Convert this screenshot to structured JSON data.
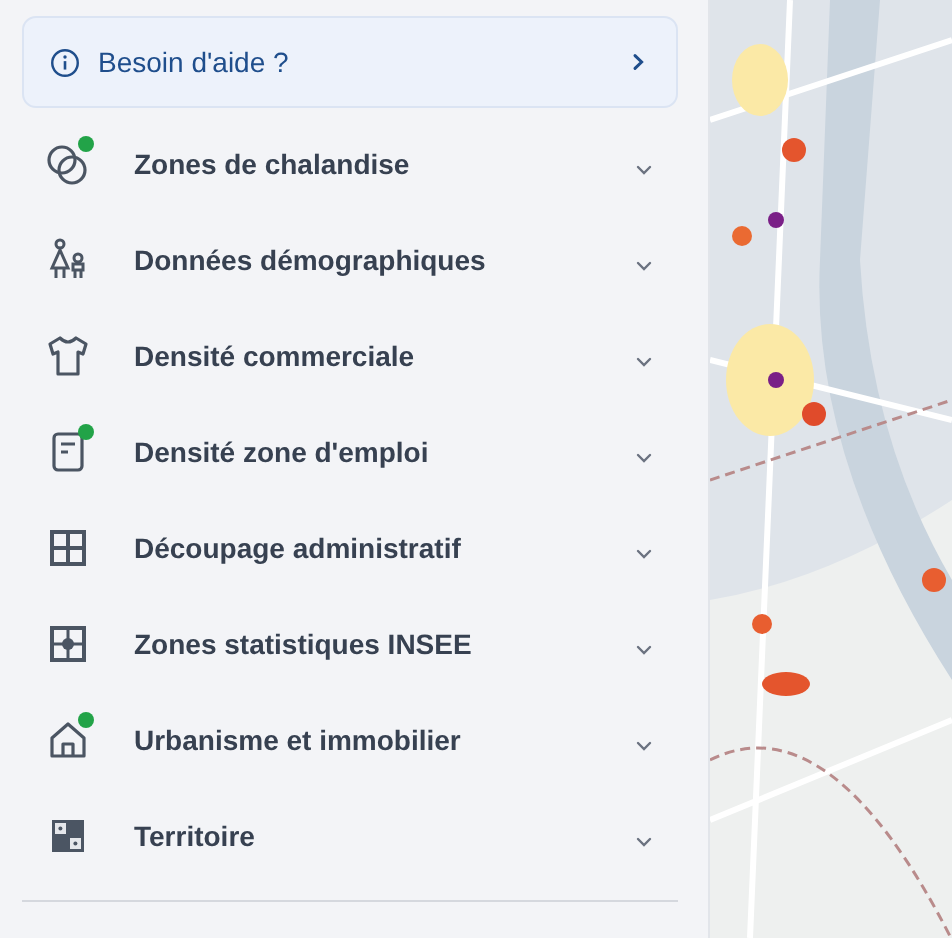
{
  "help_button": {
    "label": "Besoin d'aide ?"
  },
  "layers": [
    {
      "label": "Zones de chalandise",
      "active": true,
      "expanded": false
    },
    {
      "label": "Données démographiques",
      "active": false,
      "expanded": false
    },
    {
      "label": "Densité commerciale",
      "active": false,
      "expanded": false
    },
    {
      "label": "Densité zone d'emploi",
      "active": true,
      "expanded": false
    },
    {
      "label": "Découpage administratif",
      "active": false,
      "expanded": false
    },
    {
      "label": "Zones statistiques INSEE",
      "active": false,
      "expanded": false
    },
    {
      "label": "Urbanisme et immobilier",
      "active": true,
      "expanded": false
    },
    {
      "label": "Territoire",
      "active": false,
      "expanded": false
    }
  ]
}
